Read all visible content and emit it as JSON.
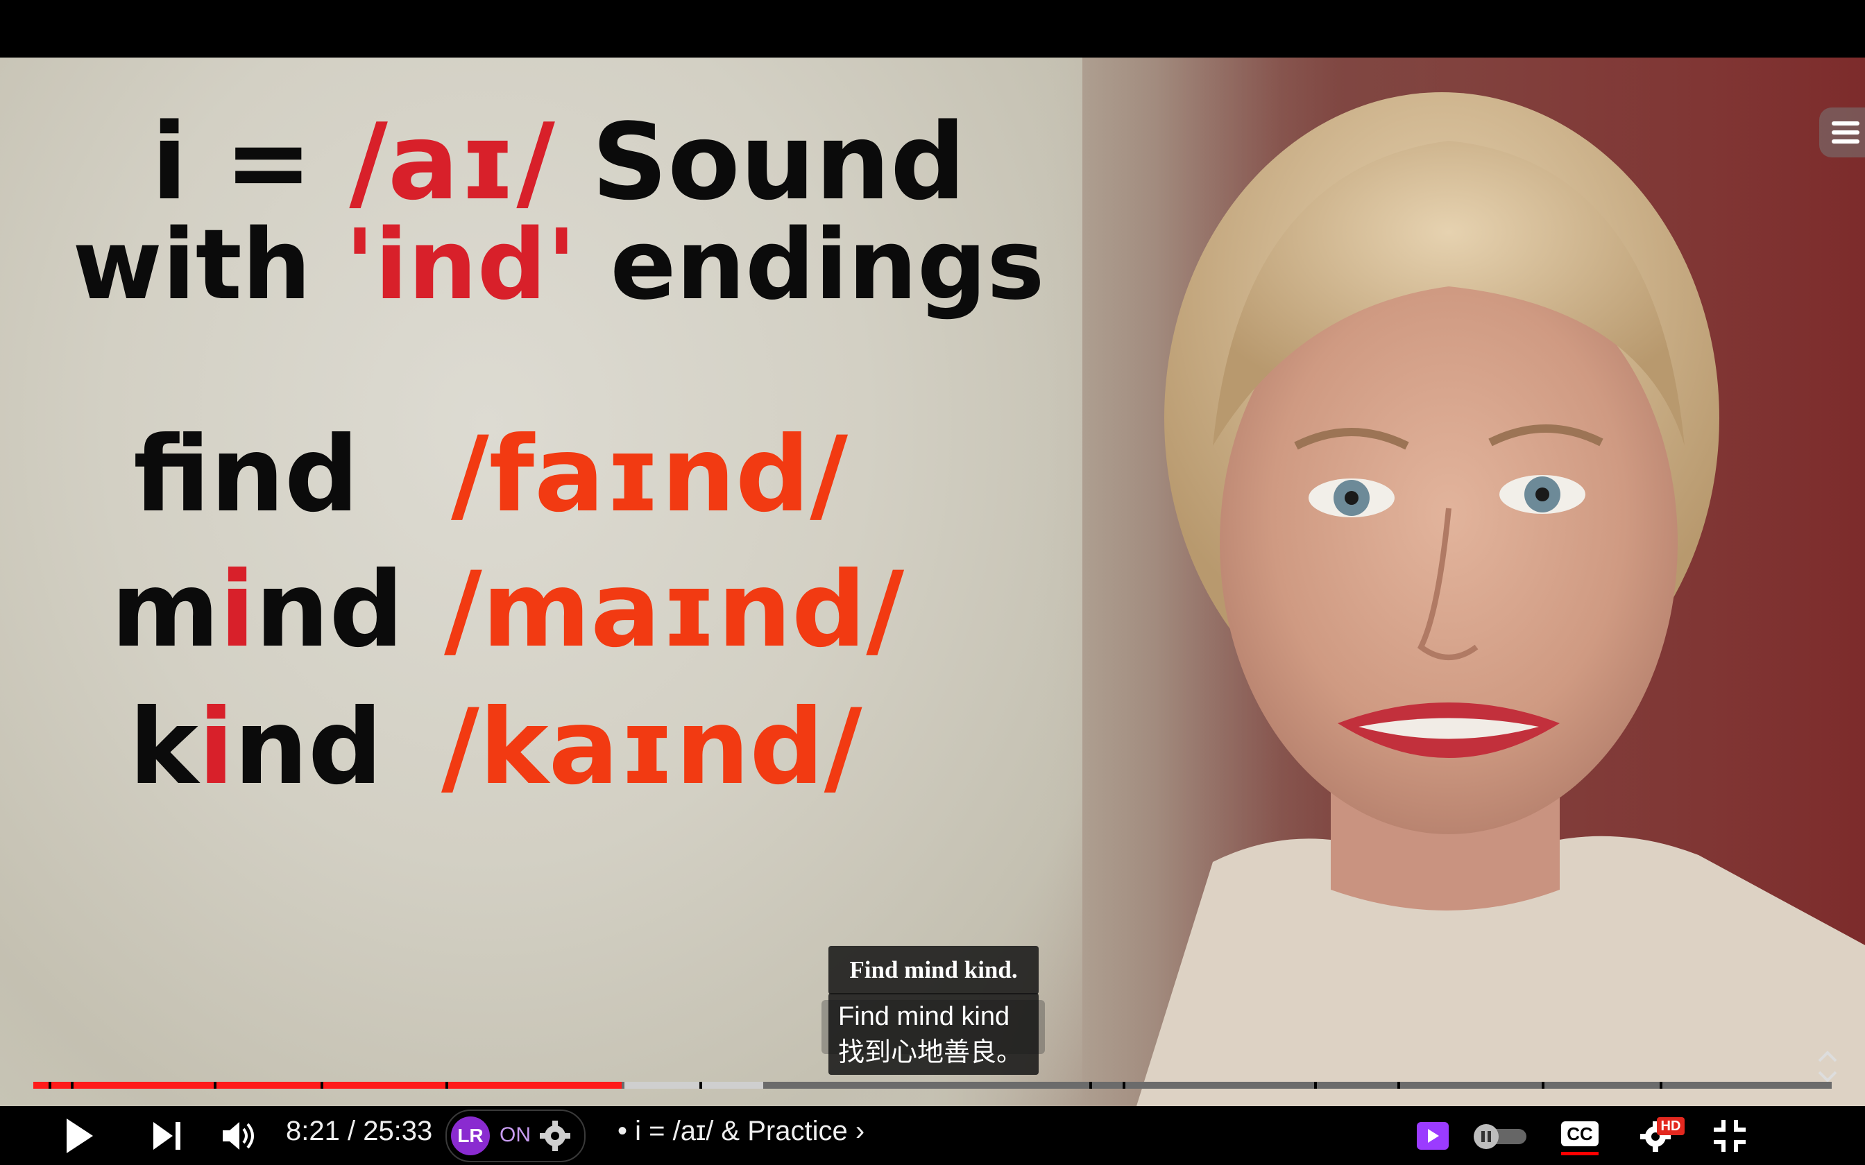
{
  "slide": {
    "title_line1_a": "i = ",
    "title_line1_b": "/aɪ/",
    "title_line1_c": "  Sound",
    "title_line2_a": "with ",
    "title_line2_b": "'ind'",
    "title_line2_c": " endings",
    "words": [
      {
        "pre": "f",
        "mid": "i",
        "post": "nd",
        "ipa": "/faɪnd/"
      },
      {
        "pre": "m",
        "mid": "i",
        "post": "nd",
        "ipa": "/maɪnd/"
      },
      {
        "pre": "k",
        "mid": "i",
        "post": "nd",
        "ipa": "/kaɪnd/"
      }
    ]
  },
  "captions": {
    "line1": "Find mind kind.",
    "line2": "Find mind kind",
    "line3": "找到心地善良。"
  },
  "player": {
    "time": "8:21 / 25:33",
    "chapter": "• i = /aɪ/ & Practice",
    "lr_label": "ON",
    "lr_logo": "LR",
    "hd_badge": "HD",
    "cc_label": "CC",
    "progress_played_fraction": 0.327,
    "colors": {
      "accent": "#ff0000",
      "buffered": "#cfcfcf",
      "track": "#6b6b6b"
    }
  }
}
